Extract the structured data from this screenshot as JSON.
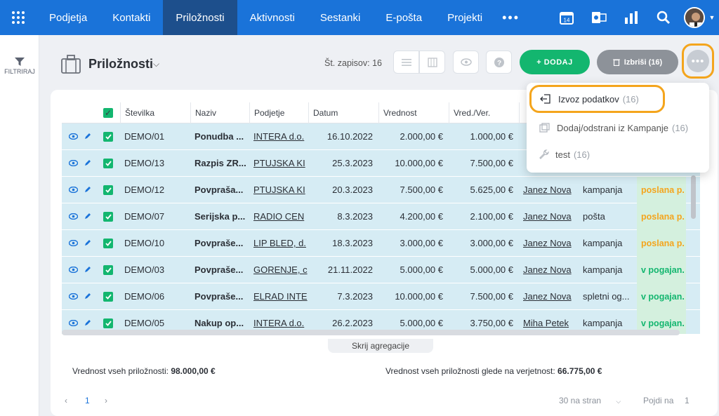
{
  "nav": {
    "tabs": [
      "Podjetja",
      "Kontakti",
      "Priložnosti",
      "Aktivnosti",
      "Sestanki",
      "E-pošta",
      "Projekti"
    ],
    "active": "Priložnosti",
    "calendar_day": "14"
  },
  "sidebar": {
    "filter_label": "FILTRIRAJ"
  },
  "header": {
    "title": "Priložnosti",
    "records_label": "Št. zapisov: 16",
    "add_label": "+ DODAJ",
    "delete_label": "Izbriši (16)"
  },
  "table": {
    "columns": [
      "Številka",
      "Naziv",
      "Podjetje",
      "Datum",
      "Vrednost",
      "Vred./Ver."
    ],
    "rows": [
      {
        "id": "DEMO/01",
        "name": "Ponudba ...",
        "company": "INTERA d.o.",
        "date": "16.10.2022",
        "value": "2.000,00 €",
        "weighted": "1.000,00 €",
        "owner": "",
        "source": "",
        "status": ""
      },
      {
        "id": "DEMO/13",
        "name": "Razpis ZR...",
        "company": "PTUJSKA KI",
        "date": "25.3.2023",
        "value": "10.000,00 €",
        "weighted": "7.500,00 €",
        "owner": "",
        "source": "",
        "status": ""
      },
      {
        "id": "DEMO/12",
        "name": "Povpraša...",
        "company": "PTUJSKA KI",
        "date": "20.3.2023",
        "value": "7.500,00 €",
        "weighted": "5.625,00 €",
        "owner": "Janez Nova",
        "source": "kampanja",
        "status": "poslana p."
      },
      {
        "id": "DEMO/07",
        "name": "Serijska p...",
        "company": "RADIO CEN",
        "date": "8.3.2023",
        "value": "4.200,00 €",
        "weighted": "2.100,00 €",
        "owner": "Janez Nova",
        "source": "pošta",
        "status": "poslana p."
      },
      {
        "id": "DEMO/10",
        "name": "Povpraše...",
        "company": "LIP BLED, d.",
        "date": "18.3.2023",
        "value": "3.000,00 €",
        "weighted": "3.000,00 €",
        "owner": "Janez Nova",
        "source": "kampanja",
        "status": "poslana p."
      },
      {
        "id": "DEMO/03",
        "name": "Povpraše...",
        "company": "GORENJE, c",
        "date": "21.11.2022",
        "value": "5.000,00 €",
        "weighted": "5.000,00 €",
        "owner": "Janez Nova",
        "source": "kampanja",
        "status": "v pogajan."
      },
      {
        "id": "DEMO/06",
        "name": "Povpraše...",
        "company": "ELRAD INTE",
        "date": "7.3.2023",
        "value": "10.000,00 €",
        "weighted": "7.500,00 €",
        "owner": "Janez Nova",
        "source": "spletni og...",
        "status": "v pogajan."
      },
      {
        "id": "DEMO/05",
        "name": "Nakup op...",
        "company": "INTERA d.o.",
        "date": "26.2.2023",
        "value": "5.000,00 €",
        "weighted": "3.750,00 €",
        "owner": "Miha Petek",
        "source": "kampanja",
        "status": "v pogajan."
      }
    ]
  },
  "aggregate_toggle": "Skrij agregacije",
  "totals": {
    "left_label": "Vrednost vseh priložnosti:",
    "left_value": "98.000,00 €",
    "right_label": "Vrednost vseh priložnosti glede na verjetnost:",
    "right_value": "66.775,00 €"
  },
  "pager": {
    "page": "1",
    "per_page": "30 na stran",
    "goto_label": "Pojdi na",
    "goto_value": "1"
  },
  "menu": {
    "items": [
      {
        "label": "Izvoz podatkov",
        "count": "(16)"
      },
      {
        "label": "Dodaj/odstrani iz Kampanje",
        "count": "(16)"
      },
      {
        "label": "test",
        "count": "(16)"
      }
    ]
  },
  "colors": {
    "accent": "#1a73d9",
    "nav_active": "#1d4f8c",
    "green": "#13b66f",
    "highlight": "#f4a51d",
    "status_orange": "#f4a51d",
    "status_green": "#13b66f"
  }
}
